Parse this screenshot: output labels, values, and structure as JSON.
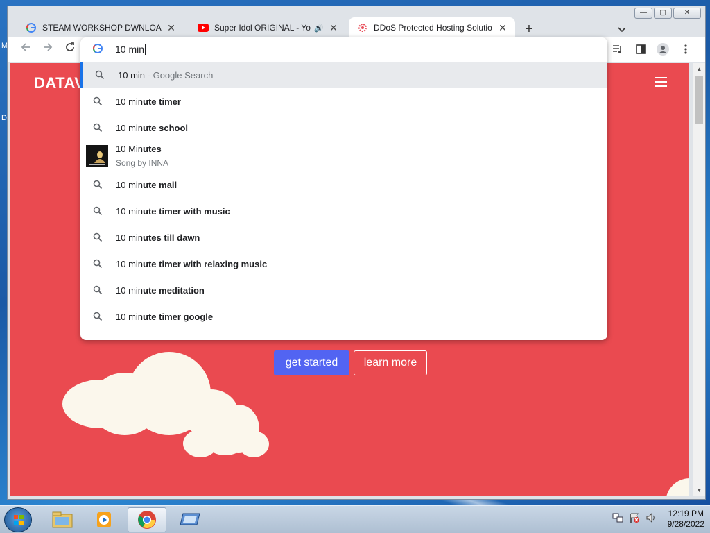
{
  "desktop": {
    "fragments": [
      "M",
      "D"
    ]
  },
  "window": {
    "controls": [
      "—",
      "▢",
      "✕"
    ]
  },
  "tabs": [
    {
      "title": "STEAM WORKSHOP DWNLOADE",
      "icon": "google-g-icon",
      "close": "✕"
    },
    {
      "title": "Super Idol ORIGINAL - YouTu",
      "icon": "youtube-icon",
      "close": "✕",
      "audio": "🔊"
    },
    {
      "title": "DDoS Protected Hosting Solutio",
      "icon": "ddos-site-icon",
      "close": "✕",
      "active": true
    }
  ],
  "new_tab": "+",
  "omnibox": {
    "value": "10 min",
    "suggestions": [
      {
        "typed": "10 min",
        "rest": "",
        "suffix": " - Google Search",
        "selected": true
      },
      {
        "typed": "10 min",
        "rest": "ute timer"
      },
      {
        "typed": "10 min",
        "rest": "ute school"
      },
      {
        "type": "song",
        "typed": "10 Min",
        "rest": "utes",
        "subtitle": "Song by INNA"
      },
      {
        "typed": "10 min",
        "rest": "ute mail"
      },
      {
        "typed": "10 min",
        "rest": "ute timer with music"
      },
      {
        "typed": "10 min",
        "rest": "utes till dawn"
      },
      {
        "typed": "10 min",
        "rest": "ute timer with relaxing music"
      },
      {
        "typed": "10 min",
        "rest": "ute meditation"
      },
      {
        "typed": "10 min",
        "rest": "ute timer google"
      }
    ]
  },
  "page": {
    "logo": "DATAV",
    "get_started": "get started",
    "learn_more": "learn more",
    "background_color": "#ea4a50",
    "primary_button_color": "#5264f2"
  },
  "taskbar": {
    "apps": [
      "explorer",
      "media-player",
      "chrome",
      "remote-desktop"
    ],
    "time": "12:19 PM",
    "date": "9/28/2022"
  }
}
